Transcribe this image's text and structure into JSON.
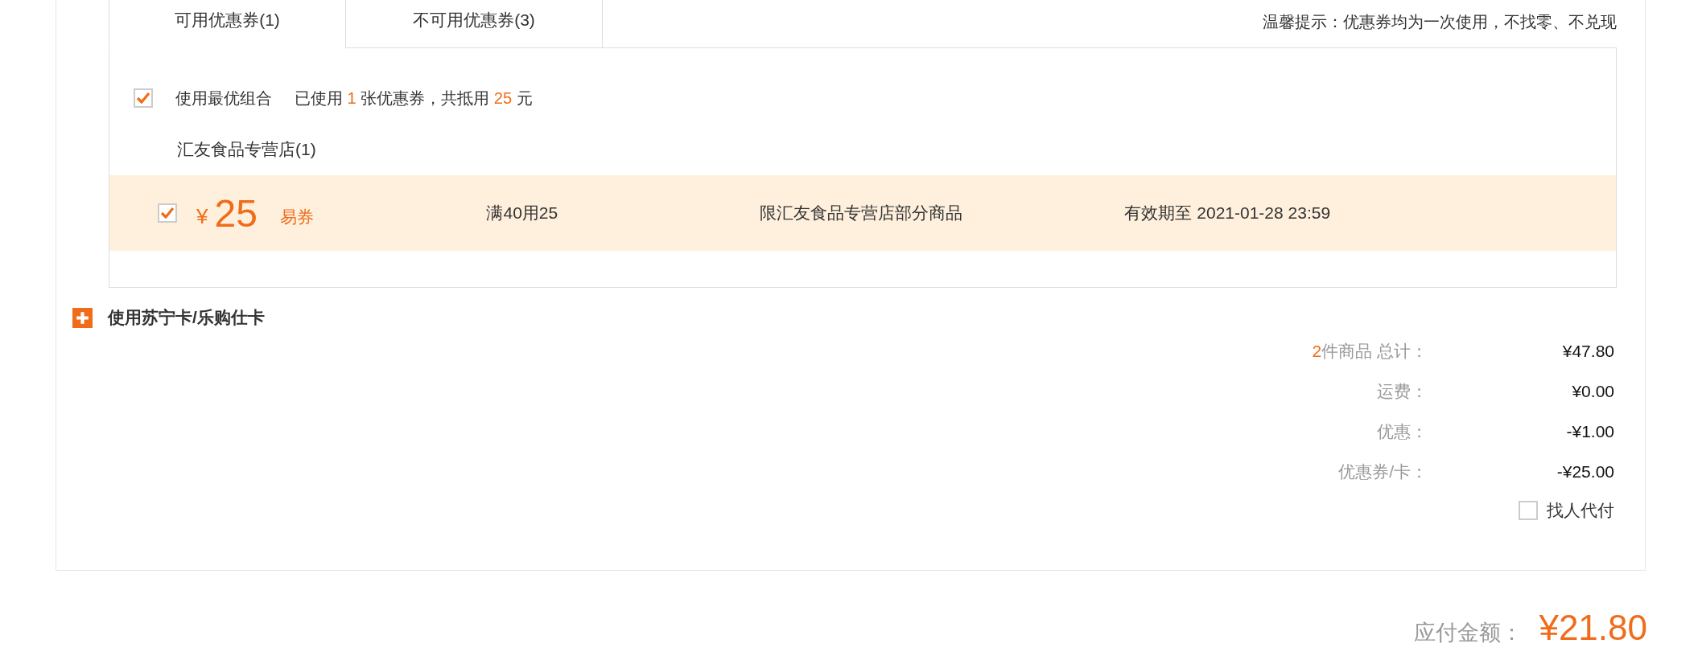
{
  "coupon_tabs": [
    {
      "label": "可用优惠券(1)",
      "selected": true
    },
    {
      "label": "不可用优惠券(3)",
      "selected": false
    }
  ],
  "hint": "温馨提示：优惠券均为一次使用，不找零、不兑现",
  "best_combo": {
    "checked": true,
    "label": "使用最优组合",
    "before": "已使用",
    "count": "1",
    "middle": "张优惠券，共抵用",
    "amount": "25",
    "after": "元"
  },
  "stores": [
    {
      "name": "汇友食品专营店(1)",
      "coupons": [
        {
          "checked": true,
          "currency": "¥",
          "value": "25",
          "type": "易券",
          "rule": "满40用25",
          "scope": "限汇友食品专营店部分商品",
          "validity": "有效期至 2021-01-28 23:59"
        }
      ]
    }
  ],
  "card_option": {
    "label": "使用苏宁卡/乐购仕卡"
  },
  "summary": [
    {
      "count": "2",
      "label": "件商品 总计：",
      "value": "¥47.80"
    },
    {
      "label": "运费：",
      "value": "¥0.00"
    },
    {
      "label": "优惠：",
      "value": "-¥1.00"
    },
    {
      "label": "优惠券/卡：",
      "value": "-¥25.00"
    }
  ],
  "pay_for_me": {
    "checked": false,
    "label": "找人代付"
  },
  "total": {
    "label": "应付金额：",
    "value": "¥21.80"
  }
}
